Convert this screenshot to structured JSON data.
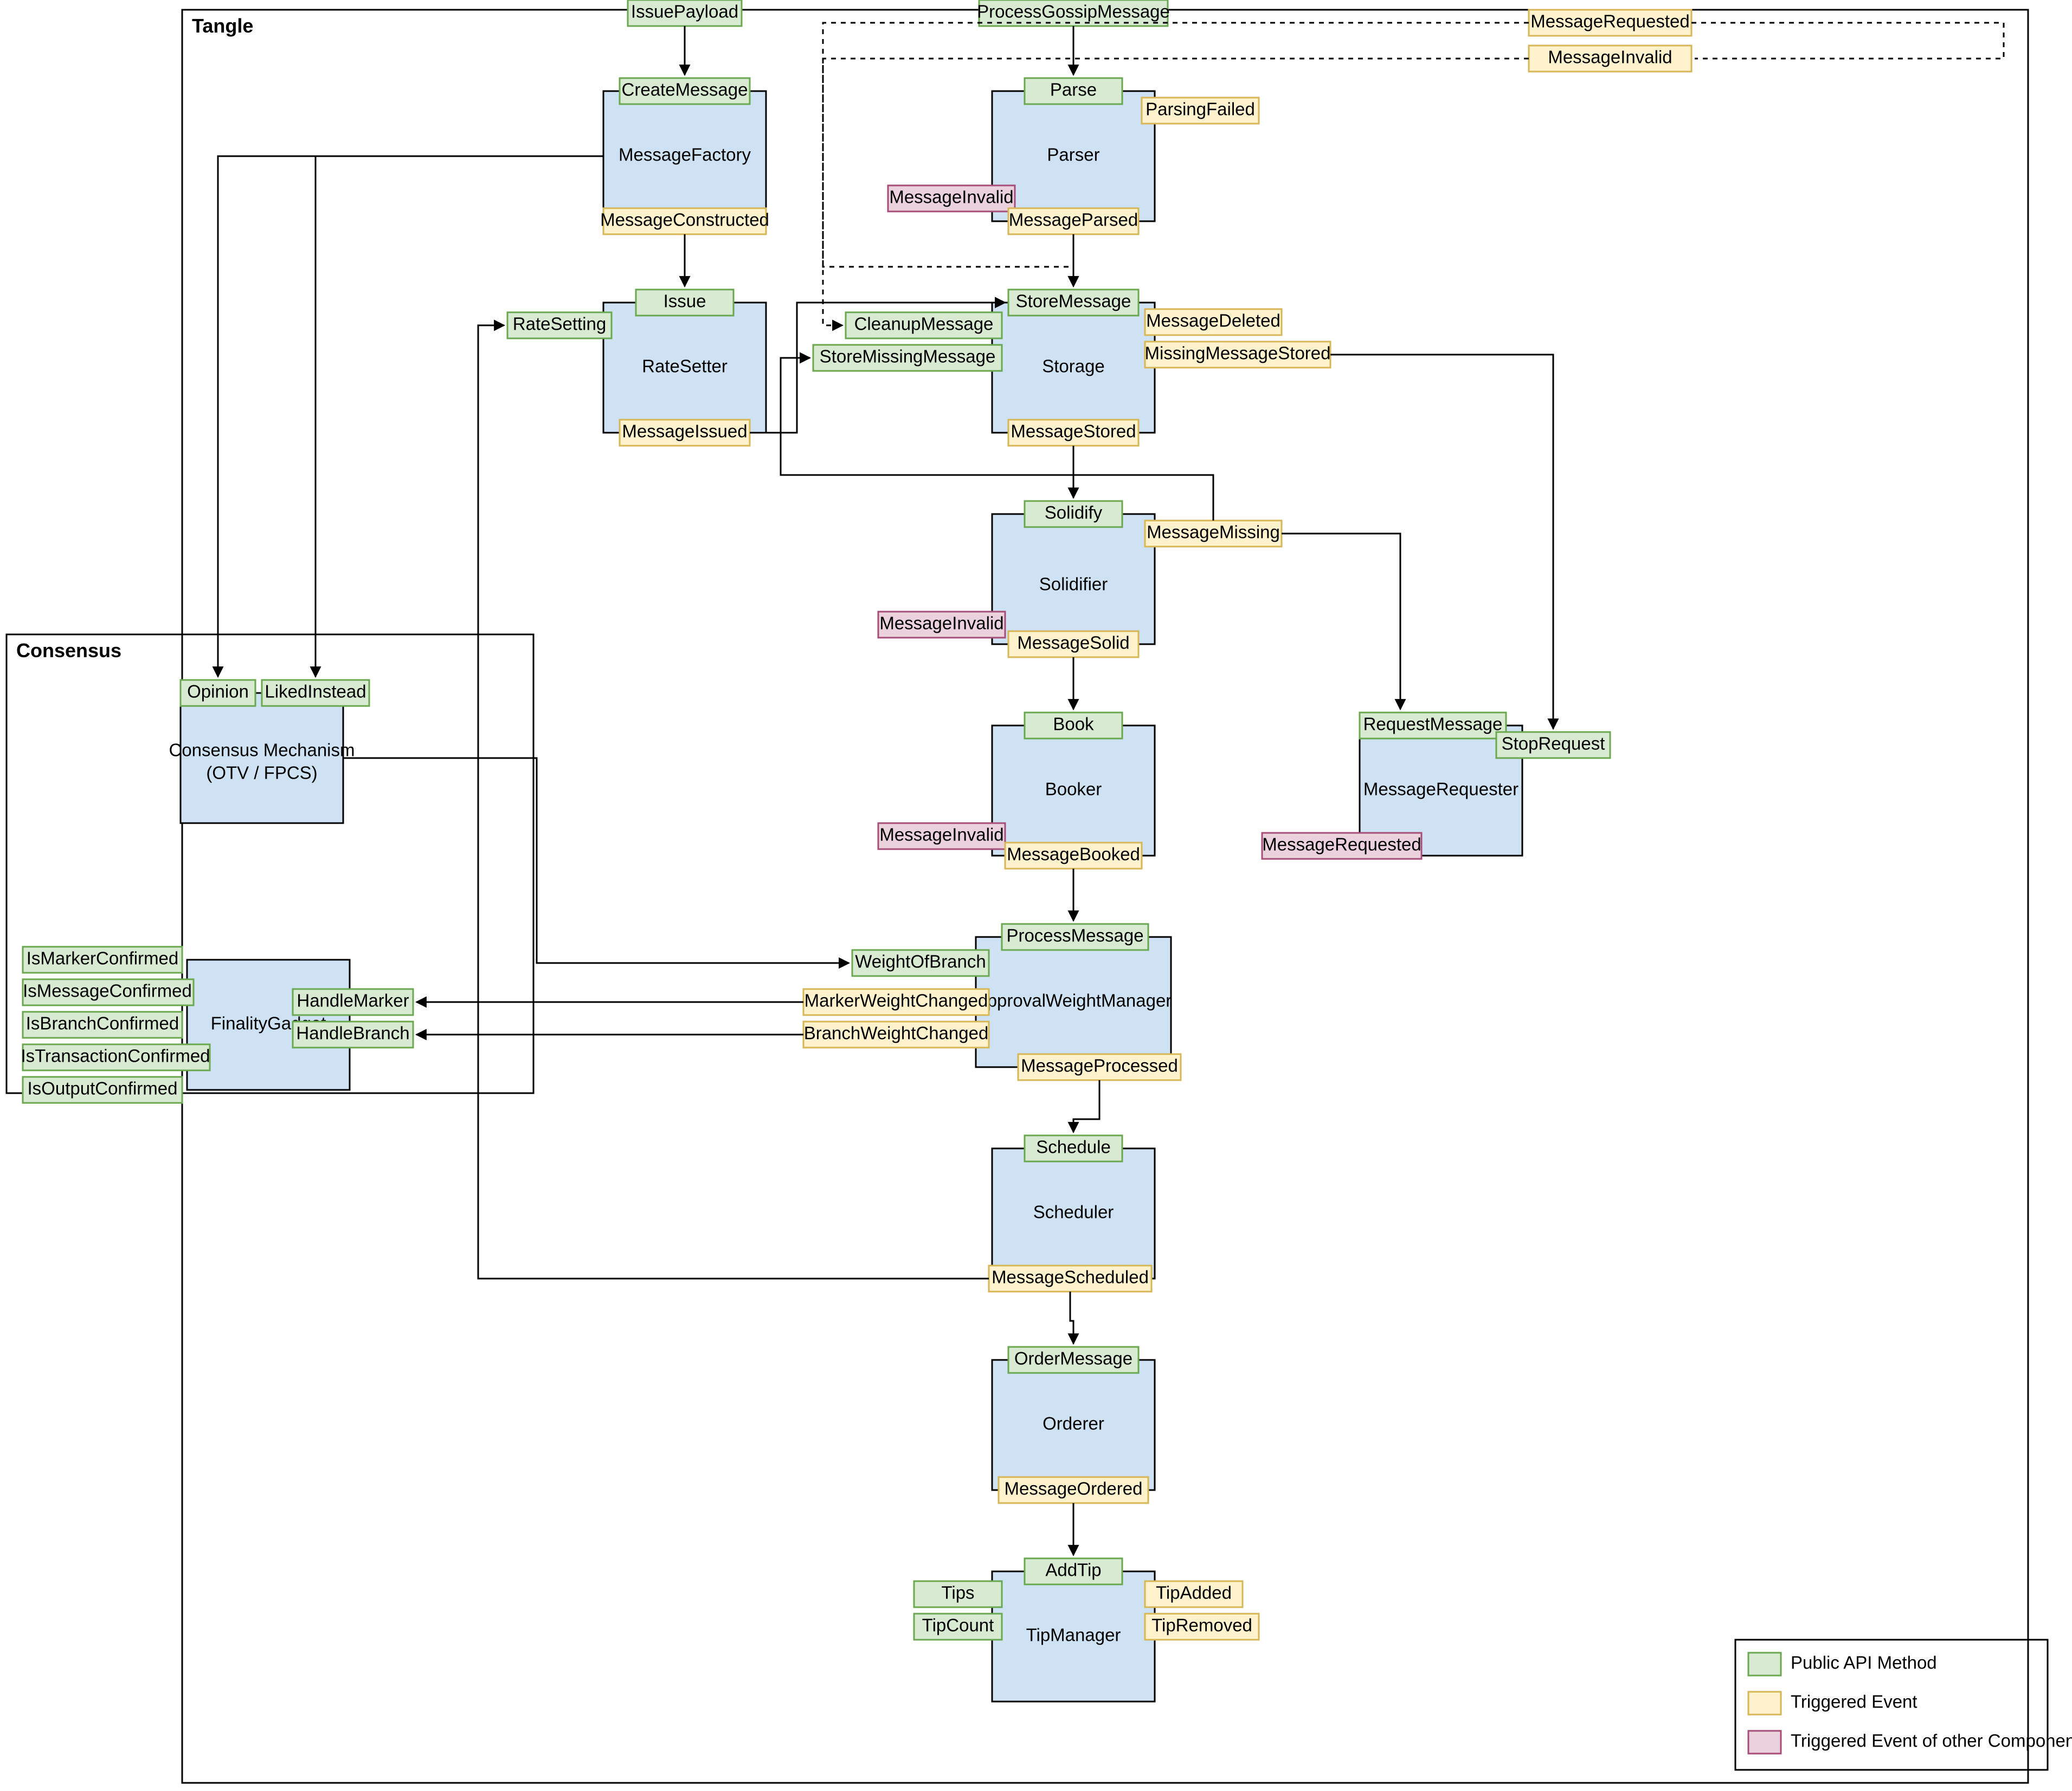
{
  "frames": {
    "tangle": "Tangle",
    "consensus": "Consensus"
  },
  "legend": {
    "api": "Public API Method",
    "evt": "Triggered Event",
    "evx": "Triggered Event of other Component"
  },
  "entry": {
    "issuePayload": "IssuePayload",
    "processGossip": "ProcessGossipMessage"
  },
  "msgFactory": {
    "name": "MessageFactory",
    "create": "CreateMessage",
    "constructed": "MessageConstructed"
  },
  "parser": {
    "name": "Parser",
    "parse": "Parse",
    "parsingFailed": "ParsingFailed",
    "invalid": "MessageInvalid",
    "parsed": "MessageParsed"
  },
  "corner": {
    "requested": "MessageRequested",
    "invalid": "MessageInvalid"
  },
  "rateSetter": {
    "name": "RateSetter",
    "issue": "Issue",
    "rateSetting": "RateSetting",
    "issued": "MessageIssued"
  },
  "storage": {
    "name": "Storage",
    "store": "StoreMessage",
    "cleanup": "CleanupMessage",
    "storeMissing": "StoreMissingMessage",
    "deleted": "MessageDeleted",
    "missingStored": "MissingMessageStored",
    "stored": "MessageStored"
  },
  "solidifier": {
    "name": "Solidifier",
    "solidify": "Solidify",
    "missing": "MessageMissing",
    "invalid": "MessageInvalid",
    "solid": "MessageSolid"
  },
  "requester": {
    "name": "MessageRequester",
    "request": "RequestMessage",
    "stop": "StopRequest",
    "requested": "MessageRequested"
  },
  "booker": {
    "name": "Booker",
    "book": "Book",
    "invalid": "MessageInvalid",
    "booked": "MessageBooked"
  },
  "consensusMech": {
    "name1": "Consensus Mechanism",
    "name2": "(OTV / FPCS)",
    "opinion": "Opinion",
    "liked": "LikedInstead"
  },
  "awm": {
    "name": "ApprovalWeightManager",
    "process": "ProcessMessage",
    "weightOfBranch": "WeightOfBranch",
    "markerChanged": "MarkerWeightChanged",
    "branchChanged": "BranchWeightChanged",
    "processed": "MessageProcessed"
  },
  "finality": {
    "name": "FinalityGadget",
    "handleMarker": "HandleMarker",
    "handleBranch": "HandleBranch",
    "isMarker": "IsMarkerConfirmed",
    "isMessage": "IsMessageConfirmed",
    "isBranch": "IsBranchConfirmed",
    "isTransaction": "IsTransactionConfirmed",
    "isOutput": "IsOutputConfirmed"
  },
  "scheduler": {
    "name": "Scheduler",
    "schedule": "Schedule",
    "scheduled": "MessageScheduled"
  },
  "orderer": {
    "name": "Orderer",
    "order": "OrderMessage",
    "ordered": "MessageOrdered"
  },
  "tipMgr": {
    "name": "TipManager",
    "addTip": "AddTip",
    "tips": "Tips",
    "tipCount": "TipCount",
    "tipAdded": "TipAdded",
    "tipRemoved": "TipRemoved"
  }
}
